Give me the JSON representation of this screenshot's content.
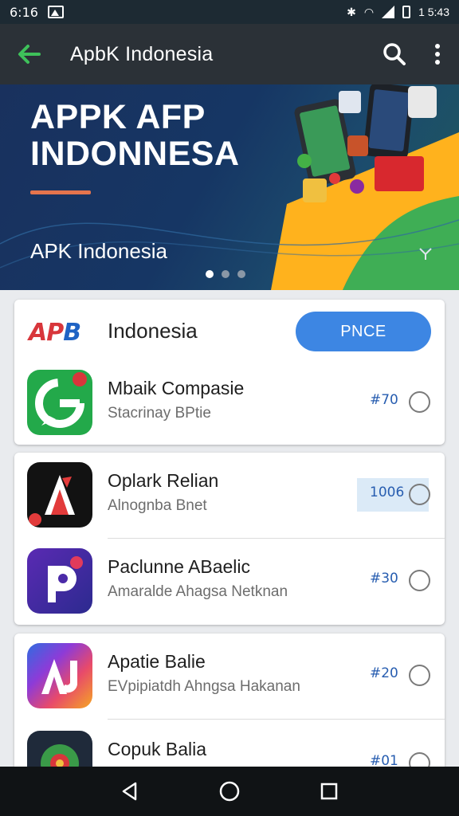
{
  "status": {
    "time": "6:16",
    "right_text": "1 5:43"
  },
  "appbar": {
    "title": "ApbK Indonesia"
  },
  "banner": {
    "headline": "APPK AFP INDONNESA",
    "subtitle": "APK Indonesia",
    "slide_count": 3,
    "active_slide": 1
  },
  "header": {
    "logo_text_red": "AP",
    "logo_text_blue": "B",
    "label": "Indonesia",
    "button_label": "PNCE"
  },
  "apps": [
    {
      "name": "Mbaik Compasie",
      "desc": "Stacrinay BPtie",
      "price": "#70"
    },
    {
      "name": "Oplark Relian",
      "desc": "Alnognba Bnet",
      "price": "1006"
    },
    {
      "name": "Paclunne ABaelic",
      "desc": "Amaralde Ahagsa Netknan",
      "price": "#30"
    },
    {
      "name": "Apatie Balie",
      "desc": "EVpipiatdh Ahngsa Hakanan",
      "price": "#20"
    },
    {
      "name": "Copuk Balia",
      "desc": "",
      "price": "#01"
    }
  ],
  "colors": {
    "accent": "#3d86e3",
    "appbar": "#2b3137",
    "back_arrow": "#3ec15a",
    "price": "#275db0"
  }
}
